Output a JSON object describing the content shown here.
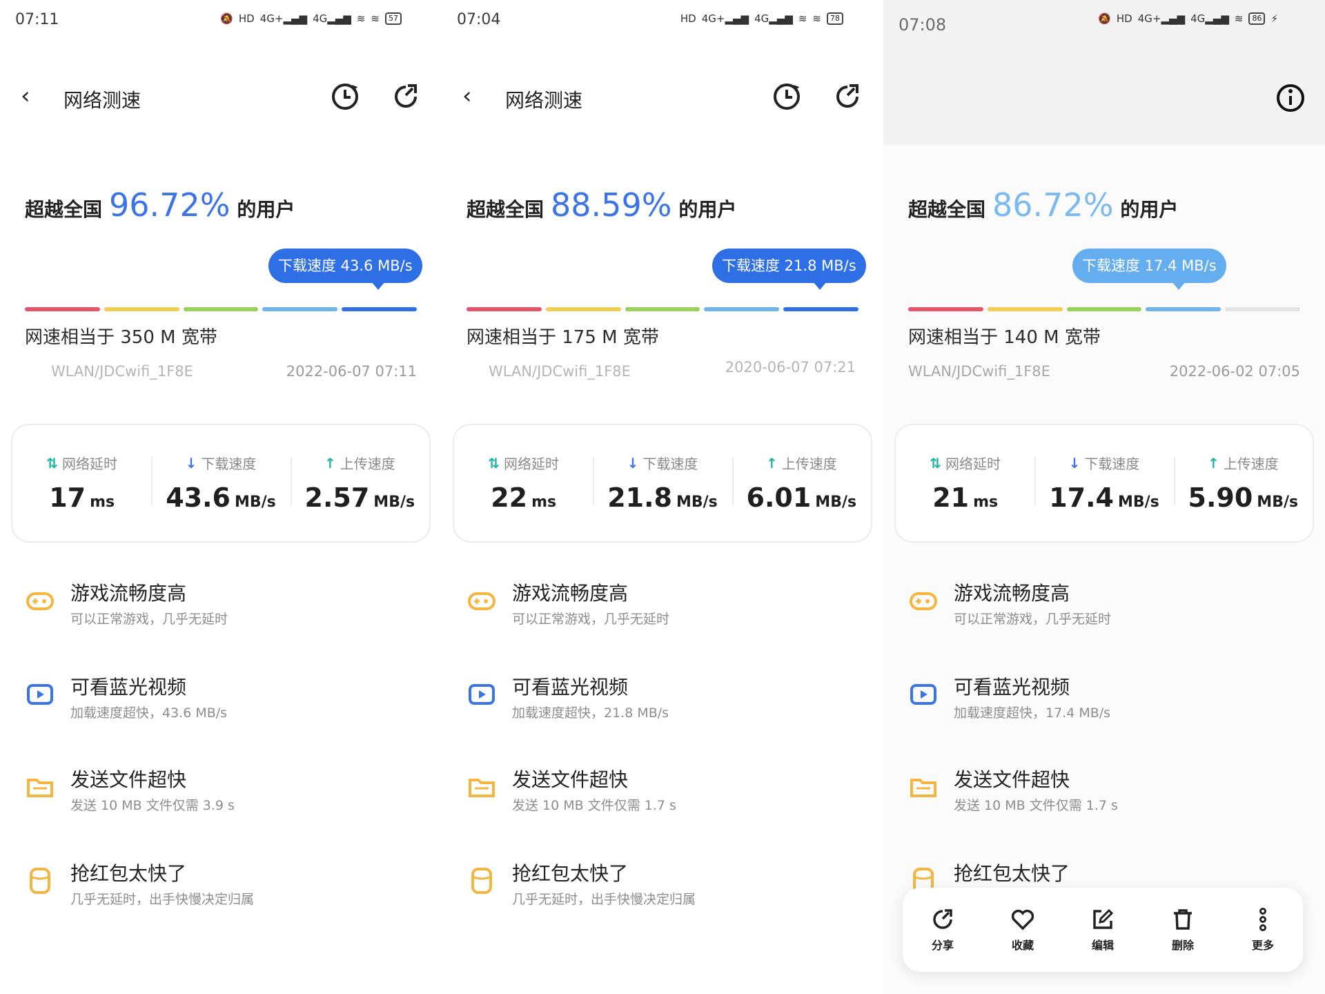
{
  "screens": [
    {
      "status_time": "07:11",
      "battery": "57",
      "title": "网络测速",
      "beat_prefix": "超越全国",
      "beat_pct": "96.72%",
      "beat_suffix": "的用户",
      "bubble": "下载速度 43.6 MB/s",
      "bubble_color": "#2f6fe6",
      "equiv": "网速相当于 350 M 宽带",
      "wifi": "WLAN/JDCwifi_1F8E",
      "time": "2022-06-07 07:11",
      "stats": [
        {
          "label": "网络延时",
          "value": "17",
          "unit": "ms"
        },
        {
          "label": "下载速度",
          "value": "43.6",
          "unit": "MB/s"
        },
        {
          "label": "上传速度",
          "value": "2.57",
          "unit": "MB/s"
        }
      ],
      "features": [
        {
          "title": "游戏流畅度高",
          "sub": "可以正常游戏，几乎无延时"
        },
        {
          "title": "可看蓝光视频",
          "sub": "加载速度超快，43.6 MB/s"
        },
        {
          "title": "发送文件超快",
          "sub": "发送 10 MB 文件仅需 3.9 s"
        },
        {
          "title": "抢红包太快了",
          "sub": "几乎无延时，出手快慢决定归属"
        }
      ]
    },
    {
      "status_time": "07:04",
      "battery": "78",
      "title": "网络测速",
      "beat_prefix": "超越全国",
      "beat_pct": "88.59%",
      "beat_suffix": "的用户",
      "bubble": "下载速度 21.8 MB/s",
      "bubble_color": "#2f6fe6",
      "equiv": "网速相当于 175 M 宽带",
      "wifi": "WLAN/JDCwifi_1F8E",
      "time": "2020-06-07 07:21",
      "stats": [
        {
          "label": "网络延时",
          "value": "22",
          "unit": "ms"
        },
        {
          "label": "下载速度",
          "value": "21.8",
          "unit": "MB/s"
        },
        {
          "label": "上传速度",
          "value": "6.01",
          "unit": "MB/s"
        }
      ],
      "features": [
        {
          "title": "游戏流畅度高",
          "sub": "可以正常游戏，几乎无延时"
        },
        {
          "title": "可看蓝光视频",
          "sub": "加载速度超快，21.8 MB/s"
        },
        {
          "title": "发送文件超快",
          "sub": "发送 10 MB 文件仅需 1.7 s"
        },
        {
          "title": "抢红包太快了",
          "sub": "几乎无延时，出手快慢决定归属"
        }
      ]
    },
    {
      "status_time": "07:08",
      "battery": "86",
      "beat_prefix": "超越全国",
      "beat_pct": "86.72%",
      "beat_suffix": "的用户",
      "bubble": "下载速度 17.4 MB/s",
      "bubble_color": "#64aef0",
      "equiv": "网速相当于 140 M 宽带",
      "wifi": "WLAN/JDCwifi_1F8E",
      "time": "2022-06-02 07:05",
      "stats": [
        {
          "label": "网络延时",
          "value": "21",
          "unit": "ms"
        },
        {
          "label": "下载速度",
          "value": "17.4",
          "unit": "MB/s"
        },
        {
          "label": "上传速度",
          "value": "5.90",
          "unit": "MB/s"
        }
      ],
      "features": [
        {
          "title": "游戏流畅度高",
          "sub": "可以正常游戏，几乎无延时"
        },
        {
          "title": "可看蓝光视频",
          "sub": "加载速度超快，17.4 MB/s"
        },
        {
          "title": "发送文件超快",
          "sub": "发送 10 MB 文件仅需 1.7 s"
        },
        {
          "title": "抢红包太快了",
          "sub": ""
        }
      ],
      "actions": [
        {
          "label": "分享",
          "icon": "share-icon"
        },
        {
          "label": "收藏",
          "icon": "heart-icon"
        },
        {
          "label": "编辑",
          "icon": "edit-icon"
        },
        {
          "label": "删除",
          "icon": "trash-icon"
        },
        {
          "label": "更多",
          "icon": "more-icon"
        }
      ]
    }
  ],
  "scale_colors": [
    "#e8536c",
    "#f2cc57",
    "#97d25a",
    "#6fb4ee",
    "#2f6fe6"
  ],
  "scale_colors_third": [
    "#e8536c",
    "#f2cc57",
    "#97d25a",
    "#6fb4ee",
    "#e3e3e3"
  ],
  "feature_icons": [
    "gamepad-icon",
    "video-play-icon",
    "folder-icon",
    "red-packet-icon"
  ],
  "feature_icon_colors": [
    "#f5b640",
    "#3a74e6",
    "#f5b640",
    "#f5b640"
  ]
}
